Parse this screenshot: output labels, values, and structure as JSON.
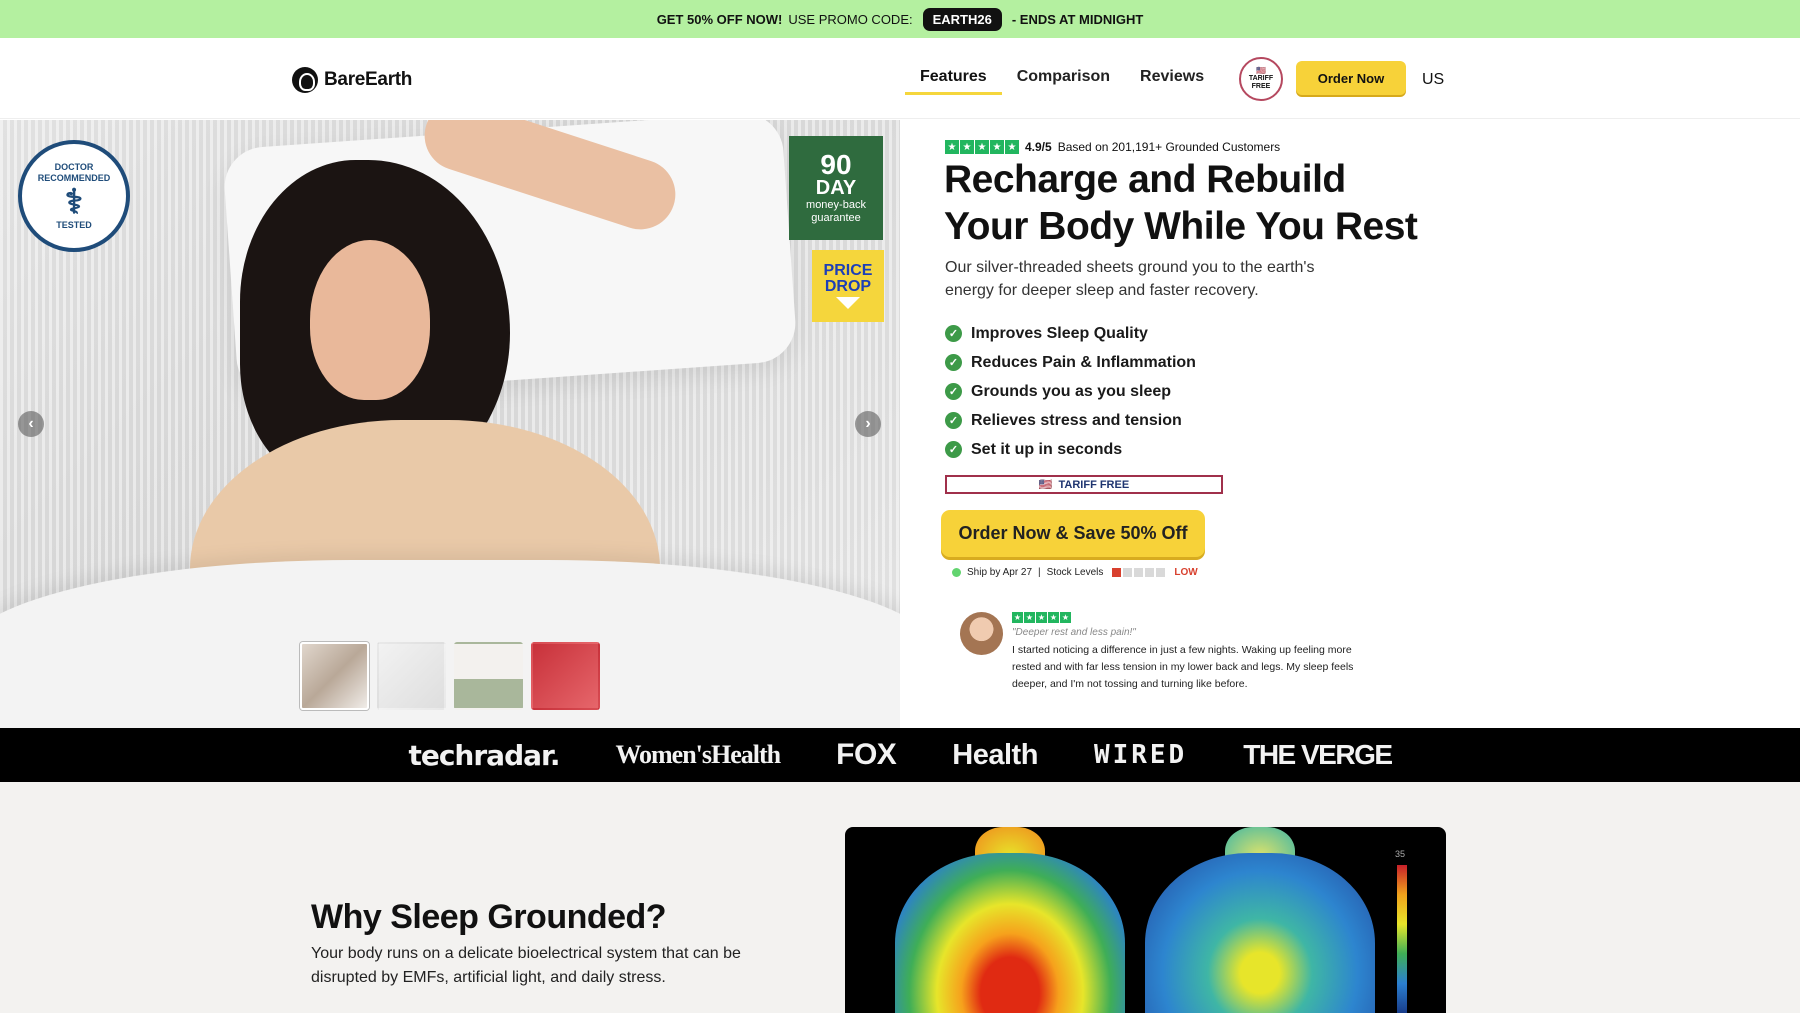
{
  "promo": {
    "lead": "GET 50% OFF NOW!",
    "middle": "USE PROMO CODE:",
    "code": "EARTH26",
    "tail": "- ENDS AT MIDNIGHT"
  },
  "header": {
    "brand": "BareEarth",
    "nav": [
      "Features",
      "Comparison",
      "Reviews"
    ],
    "active_nav": "Features",
    "tariff_badge_lines": [
      "TARIFF",
      "FREE"
    ],
    "order_button": "Order Now",
    "region": "US"
  },
  "hero": {
    "doctor_badge_lines": [
      "DOCTOR RECOMMENDED",
      "TESTED"
    ],
    "money_back": {
      "number": "90",
      "unit": "DAY",
      "line1": "money-back",
      "line2": "guarantee"
    },
    "price_drop_lines": [
      "PRICE",
      "DROP"
    ],
    "prev_arrow": "‹",
    "next_arrow": "›",
    "thumbnails_count": 4,
    "active_thumbnail": 1,
    "rating": {
      "score": "4.9/5",
      "text": "Based on 201,191+ Grounded Customers",
      "stars": 5
    },
    "headline_line1": "Recharge and Rebuild",
    "headline_line2": "Your Body While You Rest",
    "subhead": "Our silver-threaded sheets ground you to the earth's energy for deeper sleep and faster recovery.",
    "benefits": [
      "Improves Sleep Quality",
      "Reduces Pain & Inflammation",
      "Grounds you as you sleep",
      "Relieves stress and tension",
      "Set it up in seconds"
    ],
    "tariff_strip": "TARIFF FREE",
    "cta": "Order Now & Save 50% Off",
    "ship": {
      "ship_text": "Ship by Apr 27",
      "divider": "|",
      "stock_label": "Stock Levels",
      "stock_level": 0.2,
      "stock_status": "LOW"
    },
    "review": {
      "stars": 5,
      "title": "\"Deeper rest and less pain!\"",
      "text": "I started noticing a difference in just a few nights. Waking up feeling more rested and with far less tension in my lower back and legs. My sleep feels deeper, and I'm not tossing and turning like before."
    }
  },
  "press": [
    "techradar.",
    "Women'sHealth",
    "FOX",
    "Health",
    "WIRED",
    "THE VERGE"
  ],
  "section": {
    "title": "Why Sleep Grounded?",
    "text": "Your body runs on a delicate bioelectrical system that can be disrupted by EMFs, artificial light, and daily stress.",
    "thermal_scale_max": "35"
  },
  "colors": {
    "promo_bg": "#b4f0a0",
    "cta_yellow": "#f7d239",
    "star_green": "#22b65f",
    "check_green": "#3d9a48",
    "stock_red": "#d8402e"
  }
}
